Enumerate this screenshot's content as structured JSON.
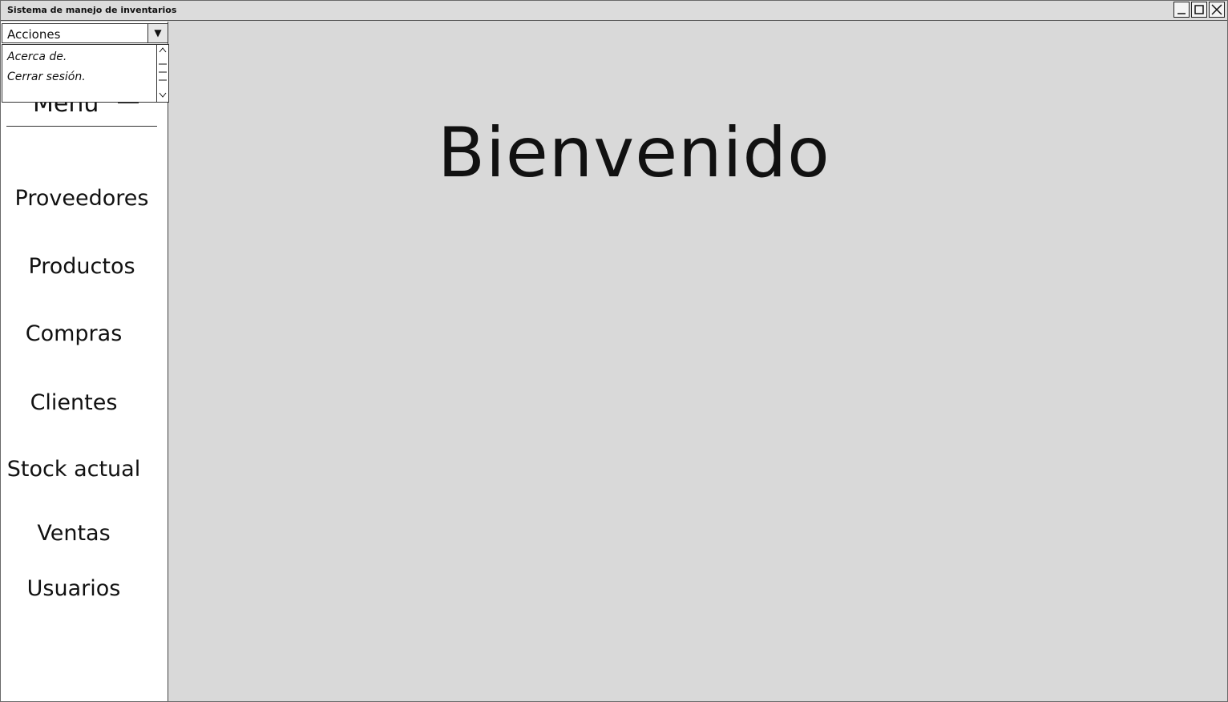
{
  "window": {
    "title": "Sistema de manejo de inventarios",
    "controls": [
      "minimize-icon",
      "maximize-icon",
      "close-icon"
    ]
  },
  "actions_select": {
    "value": "Acciones",
    "options": [
      "Acerca de.",
      "Cerrar sesión."
    ]
  },
  "sidebar": {
    "header": "Menú",
    "items": [
      {
        "label": "Proveedores"
      },
      {
        "label": "Productos"
      },
      {
        "label": "Compras"
      },
      {
        "label": "Clientes"
      },
      {
        "label": "Stock actual"
      },
      {
        "label": "Ventas"
      },
      {
        "label": "Usuarios"
      }
    ]
  },
  "main": {
    "welcome_text": "Bienvenido"
  },
  "colors": {
    "background": "#d9d9d9",
    "sidebar": "#ffffff",
    "text": "#111111"
  }
}
